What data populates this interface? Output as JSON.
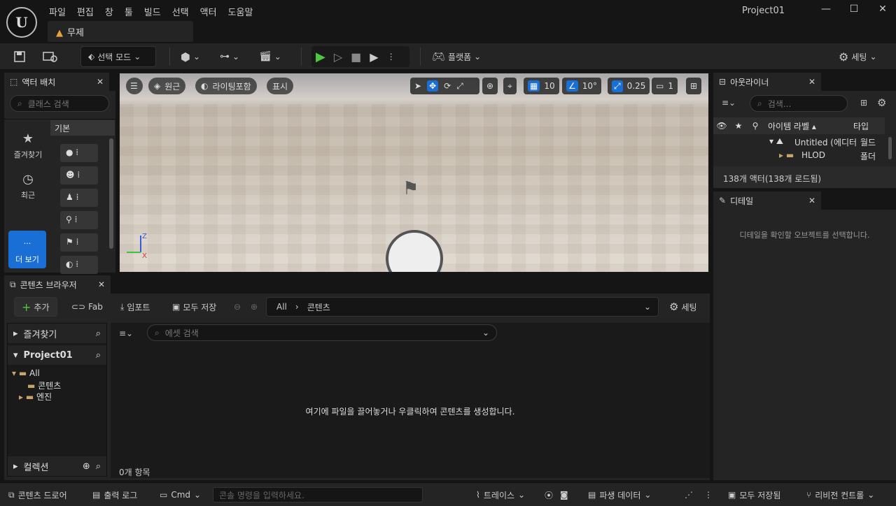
{
  "app": {
    "project": "Project01",
    "tab": "무제"
  },
  "menu": [
    "파일",
    "편집",
    "창",
    "툴",
    "빌드",
    "선택",
    "액터",
    "도움말"
  ],
  "toolbar": {
    "select_mode": "선택 모드",
    "platform": "플랫폼",
    "settings": "세팅"
  },
  "place_actors": {
    "title": "액터 배치",
    "search_placeholder": "클래스 검색",
    "categories": [
      "즐겨찾기",
      "최근"
    ],
    "more": "더 보기",
    "basic": "기본"
  },
  "viewport": {
    "perspective": "원근",
    "lit": "라이팅포함",
    "show": "표시",
    "grid_snap": "10",
    "rot_snap": "10°",
    "scale_snap": "0.25",
    "camera_speed": "1"
  },
  "outliner": {
    "title": "아웃라이너",
    "search_placeholder": "검색...",
    "col_label": "아이템 라벨 ▴",
    "col_type": "타입",
    "rows": [
      {
        "label": "Untitled (에디터",
        "type": "월드"
      },
      {
        "label": "HLOD",
        "type": "폴더"
      }
    ],
    "count": "138개 액터(138개 로드됨)"
  },
  "details": {
    "title": "디테일",
    "empty": "디테일을 확인할 오브젝트를 선택합니다."
  },
  "content_browser": {
    "title": "콘텐츠 브라우저",
    "add": "추가",
    "fab": "Fab",
    "import": "임포트",
    "save_all": "모두 저장",
    "path": [
      "All",
      "콘텐츠"
    ],
    "settings": "세팅",
    "favorites": "즐겨찾기",
    "project": "Project01",
    "tree": [
      "All",
      "콘텐츠",
      "엔진"
    ],
    "collections": "컬렉션",
    "asset_search_placeholder": "에셋 검색",
    "empty_hint": "여기에 파일을 끌어놓거나 우클릭하여 콘텐츠를 생성합니다.",
    "item_count": "0개 항목"
  },
  "statusbar": {
    "drawer": "콘텐츠 드로어",
    "output_log": "출력 로그",
    "cmd": "Cmd",
    "console_placeholder": "콘솔 명령을 입력하세요.",
    "trace": "트레이스",
    "derived_data": "파생 데이터",
    "all_saved": "모두 저장됨",
    "revision": "리비전 컨트롤"
  }
}
